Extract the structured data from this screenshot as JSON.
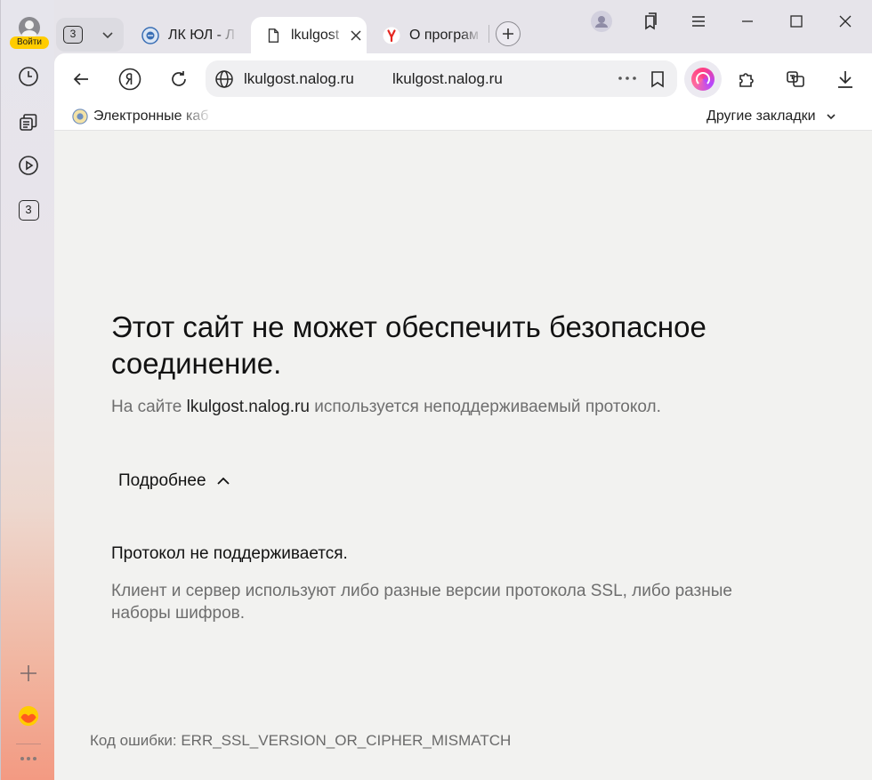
{
  "sidebar": {
    "login_label": "Войти",
    "tabs_count": "3",
    "icons": [
      "clock-icon",
      "collections-icon",
      "video-play-icon",
      "tabs-counter-icon",
      "add-icon",
      "yandex-mail-icon",
      "more-icon"
    ]
  },
  "tabs": {
    "counter": "3",
    "items": [
      {
        "label": "ЛК ЮЛ - Л",
        "favicon": "nalog-emblem-icon",
        "active": false
      },
      {
        "label": "lkulgost",
        "favicon": "page-icon",
        "active": true
      },
      {
        "label": "О програм",
        "favicon": "yandex-icon",
        "active": false
      }
    ]
  },
  "toolbar": {
    "omnibox_domain": "lkulgost.nalog.ru",
    "omnibox_url": "lkulgost.nalog.ru"
  },
  "bookmarks": {
    "item_label": "Электронные каб",
    "other_label": "Другие закладки"
  },
  "error_page": {
    "title": "Этот сайт не может обеспечить безопасное соединение.",
    "desc_prefix": "На сайте",
    "desc_host": "lkulgost.nalog.ru",
    "desc_suffix": "используется неподдерживаемый протокол.",
    "details_label": "Подробнее",
    "detail_heading": "Протокол не поддерживается.",
    "detail_text": "Клиент и сервер используют либо разные версии протокола SSL, либо разные наборы шифров.",
    "error_code": "Код ошибки: ERR_SSL_VERSION_OR_CIPHER_MISMATCH"
  },
  "colors": {
    "login_badge": "#ffcc00",
    "page_bg": "#f2f2f0",
    "alice_accent": "#ff3d7f"
  }
}
